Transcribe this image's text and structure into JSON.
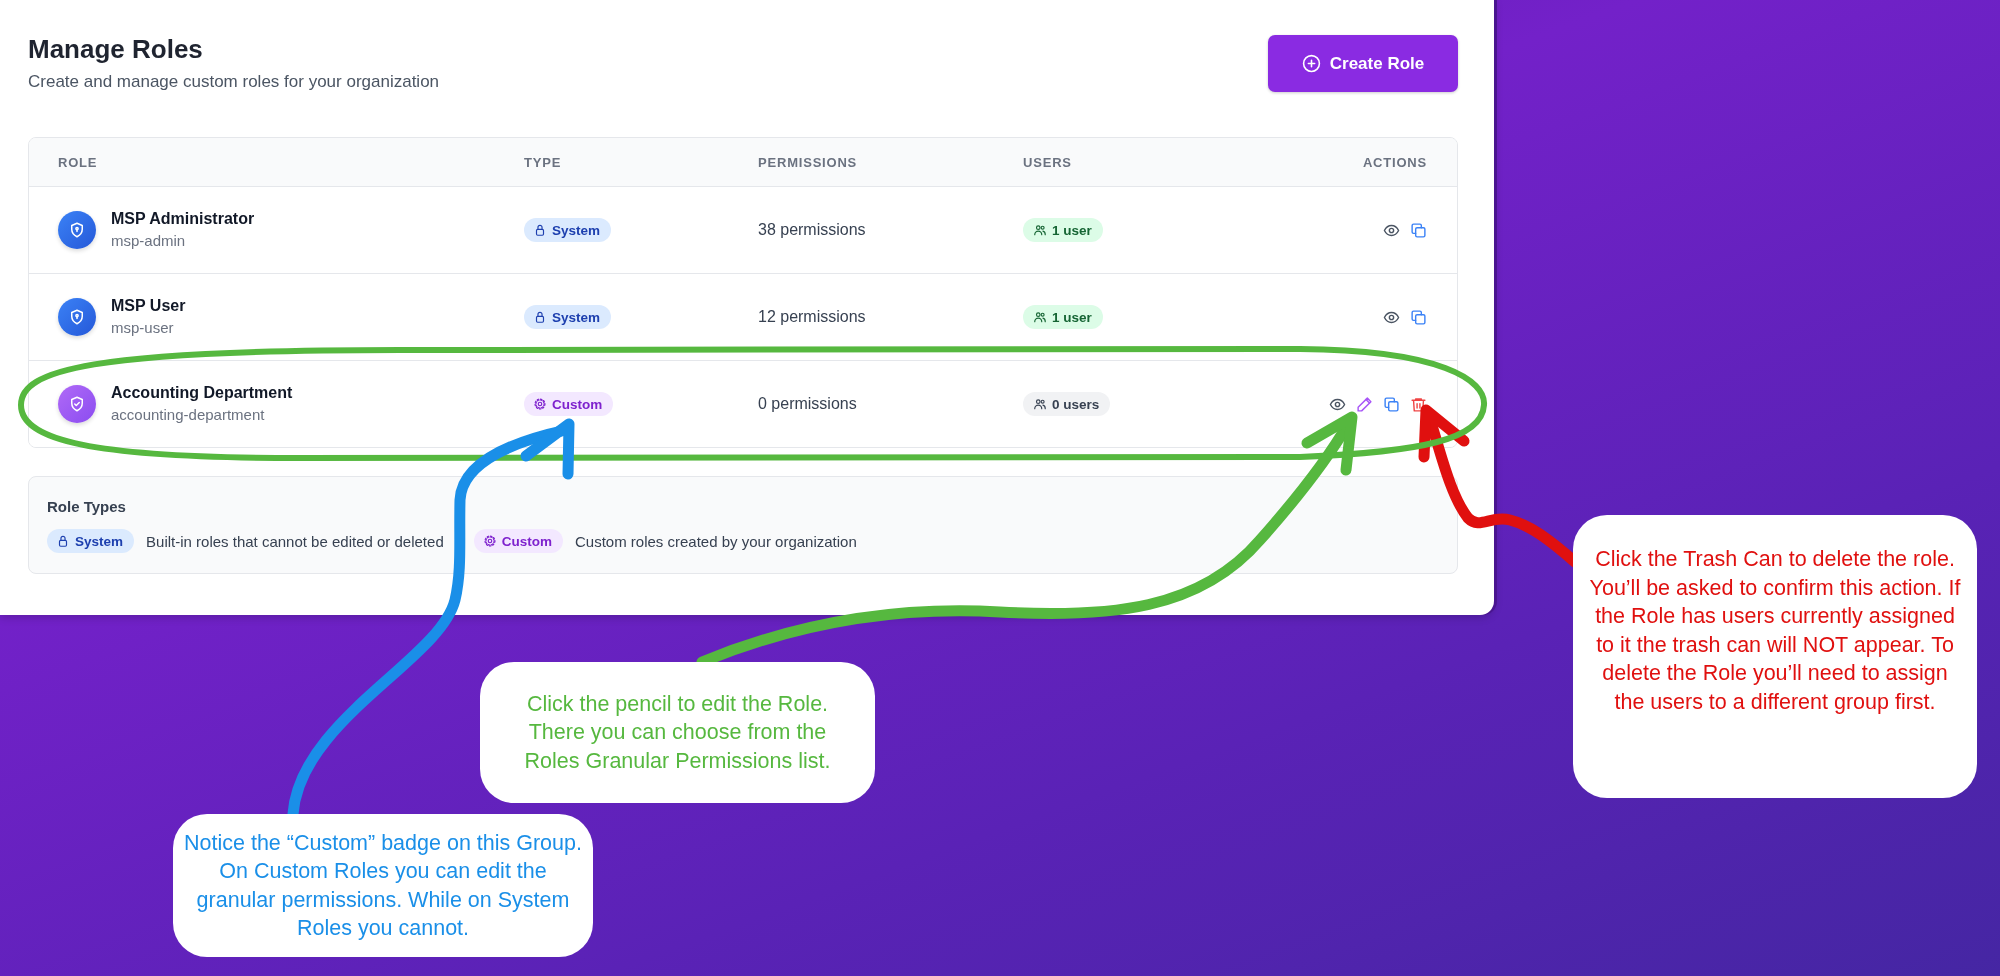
{
  "page": {
    "title": "Manage Roles",
    "subtitle": "Create and manage custom roles for your organization",
    "create_button": "Create Role"
  },
  "table": {
    "columns": [
      "ROLE",
      "TYPE",
      "PERMISSIONS",
      "USERS",
      "ACTIONS"
    ],
    "rows": [
      {
        "name": "MSP Administrator",
        "slug": "msp-admin",
        "type": {
          "kind": "system",
          "label": "System"
        },
        "permissions": "38 permissions",
        "users": {
          "kind": "assigned",
          "label": "1 user"
        },
        "actions": [
          {
            "kind": "view"
          },
          {
            "kind": "copy"
          }
        ]
      },
      {
        "name": "MSP User",
        "slug": "msp-user",
        "type": {
          "kind": "system",
          "label": "System"
        },
        "permissions": "12 permissions",
        "users": {
          "kind": "assigned",
          "label": "1 user"
        },
        "actions": [
          {
            "kind": "view"
          },
          {
            "kind": "copy"
          }
        ]
      },
      {
        "name": "Accounting Department",
        "slug": "accounting-department",
        "type": {
          "kind": "custom",
          "label": "Custom"
        },
        "permissions": "0 permissions",
        "users": {
          "kind": "empty",
          "label": "0 users"
        },
        "actions": [
          {
            "kind": "view"
          },
          {
            "kind": "edit"
          },
          {
            "kind": "copy"
          },
          {
            "kind": "delete"
          }
        ]
      }
    ]
  },
  "role_types": {
    "title": "Role Types",
    "items": [
      {
        "kind": "system",
        "label": "System",
        "description": "Built-in roles that cannot be edited or deleted"
      },
      {
        "kind": "custom",
        "label": "Custom",
        "description": "Custom roles created by your organization"
      }
    ]
  },
  "callouts": [
    {
      "kind": "delete",
      "color": "#e0100f",
      "text": "Click the Trash Can to delete the role. You’ll be asked to confirm this action. If the Role has users currently assigned to it the trash can will NOT appear. To delete the Role you’ll need to assign the users to a different group first."
    },
    {
      "kind": "edit",
      "color": "#56b83f",
      "text": "Click the pencil to edit the Role. There you can choose from the Roles Granular Permissions list."
    },
    {
      "kind": "type",
      "color": "#1a8fe8",
      "text": "Notice the “Custom” badge on this Group. On Custom Roles you can edit the granular permissions. While on System Roles you cannot."
    }
  ]
}
